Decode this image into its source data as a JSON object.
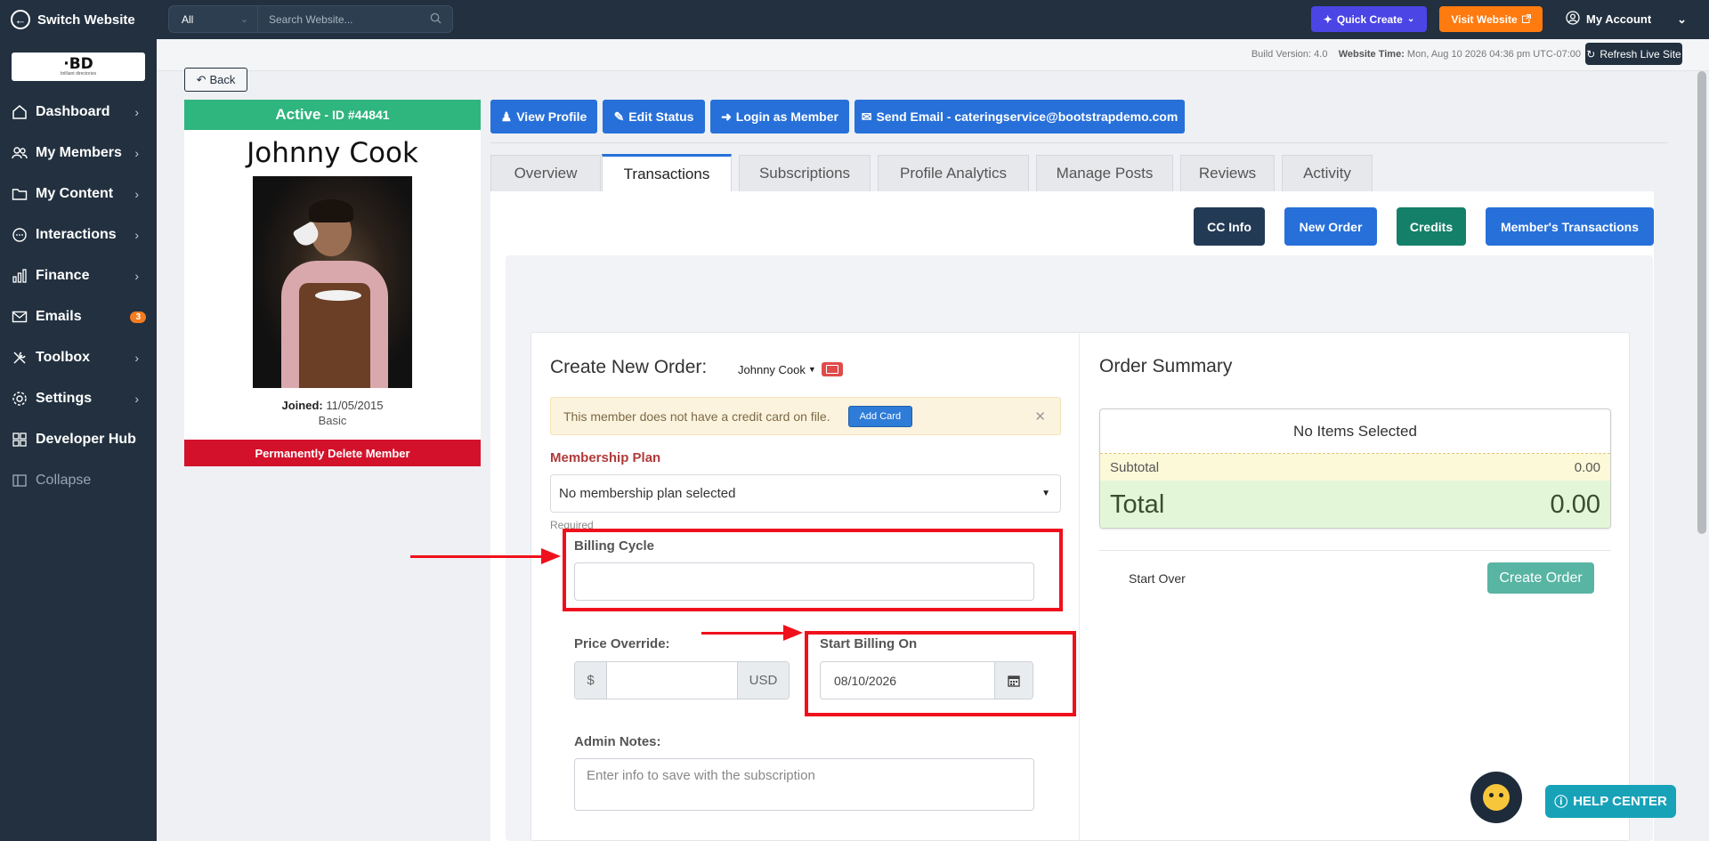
{
  "sidebar": {
    "switch_label": "Switch Website",
    "logo_big": "·BD",
    "logo_small": "brilliant directories",
    "items": [
      {
        "label": "Dashboard",
        "icon": "home-icon"
      },
      {
        "label": "My Members",
        "icon": "users-icon"
      },
      {
        "label": "My Content",
        "icon": "folder-icon"
      },
      {
        "label": "Interactions",
        "icon": "chat-icon"
      },
      {
        "label": "Finance",
        "icon": "bar-chart-icon"
      },
      {
        "label": "Emails",
        "icon": "mail-icon",
        "badge": "3"
      },
      {
        "label": "Toolbox",
        "icon": "tools-icon"
      },
      {
        "label": "Settings",
        "icon": "gear-icon"
      },
      {
        "label": "Developer Hub",
        "icon": "grid-icon"
      },
      {
        "label": "Collapse",
        "icon": "collapse-icon"
      }
    ]
  },
  "topbar": {
    "search_scope": "All",
    "search_placeholder": "Search Website...",
    "quick_create": "Quick Create",
    "visit_website": "Visit Website",
    "my_account": "My Account"
  },
  "infobar": {
    "build_label": "Build Version:",
    "build_value": "4.0",
    "time_label": "Website Time:",
    "time_value": "Mon, Aug 10 2026 04:36 pm UTC-07:00",
    "refresh": "Refresh Live Site"
  },
  "back_label": "Back",
  "profile": {
    "status": "Active",
    "id": "- ID #44841",
    "name": "Johnny Cook",
    "joined_label": "Joined:",
    "joined_date": "11/05/2015",
    "plan": "Basic",
    "delete": "Permanently Delete Member"
  },
  "actions": {
    "view_profile": "View Profile",
    "edit_status": "Edit Status",
    "login_member": "Login as Member",
    "send_email": "Send Email - cateringservice@bootstrapdemo.com"
  },
  "tabs": [
    "Overview",
    "Transactions",
    "Subscriptions",
    "Profile Analytics",
    "Manage Posts",
    "Reviews",
    "Activity"
  ],
  "active_tab": "Transactions",
  "panel_buttons": {
    "cc_info": "CC Info",
    "new_order": "New Order",
    "credits": "Credits",
    "member_transactions": "Member's Transactions"
  },
  "order_form": {
    "title": "Create New Order:",
    "member": "Johnny Cook",
    "alert_text": "This member does not have a credit card on file.",
    "add_card": "Add Card",
    "membership_label": "Membership Plan",
    "membership_value": "No membership plan selected",
    "required": "Required",
    "billing_cycle_label": "Billing Cycle",
    "billing_cycle_value": "",
    "price_override_label": "Price Override:",
    "price_prefix": "$",
    "price_suffix": "USD",
    "start_billing_label": "Start Billing On",
    "start_billing_value": "08/10/2026",
    "admin_notes_label": "Admin Notes:",
    "admin_notes_placeholder": "Enter info to save with the subscription"
  },
  "summary": {
    "title": "Order Summary",
    "no_items": "No Items Selected",
    "subtotal_label": "Subtotal",
    "subtotal_value": "0.00",
    "total_label": "Total",
    "total_value": "0.00",
    "start_over": "Start Over",
    "create_order": "Create Order"
  },
  "help": {
    "label": "HELP CENTER"
  },
  "colors": {
    "sidebar_bg": "#22303f",
    "active_green": "#2fb57e",
    "primary_blue": "#2770d9",
    "danger_red": "#d3112b",
    "annotation_red": "#f0101c",
    "quick_create": "#4b45e6",
    "visit_orange": "#ff7a0f"
  }
}
